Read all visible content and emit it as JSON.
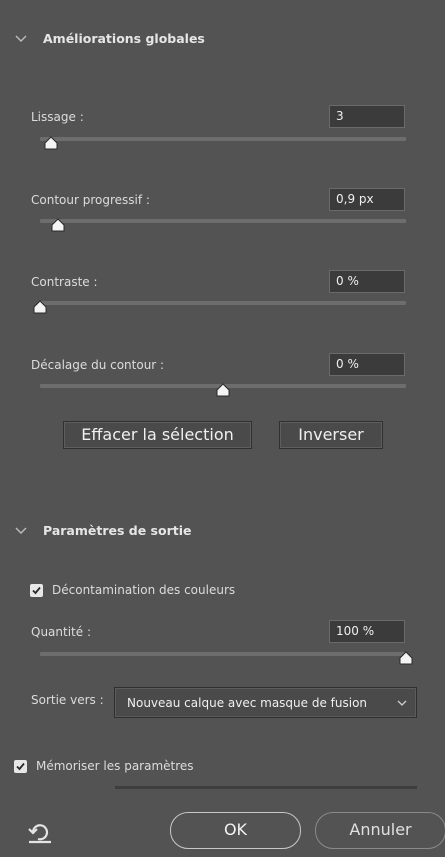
{
  "global": {
    "title": "Améliorations globales",
    "smooth": {
      "label": "Lissage :",
      "value": "3",
      "level": 0.03
    },
    "feather": {
      "label": "Contour progressif :",
      "value": "0,9 px",
      "level": 0.05
    },
    "contrast": {
      "label": "Contraste :",
      "value": "0 %",
      "level": 0.0
    },
    "shift": {
      "label": "Décalage du contour :",
      "value": "0 %",
      "level": 0.5
    },
    "clear_button": "Effacer la sélection",
    "invert_button": "Inverser"
  },
  "output": {
    "title": "Paramètres de sortie",
    "decontaminate_label": "Décontamination des couleurs",
    "decontaminate_checked": true,
    "amount": {
      "label": "Quantité :",
      "value": "100 %",
      "level": 1.0
    },
    "output_to_label": "Sortie vers :",
    "output_to_value": "Nouveau calque avec masque de fusion"
  },
  "remember_label": "Mémoriser les paramètres",
  "remember_checked": true,
  "ok_button": "OK",
  "cancel_button": "Annuler",
  "icons": {
    "reset": "reset-icon",
    "chevron": "chevron-down-icon",
    "check": "checkmark-icon"
  }
}
